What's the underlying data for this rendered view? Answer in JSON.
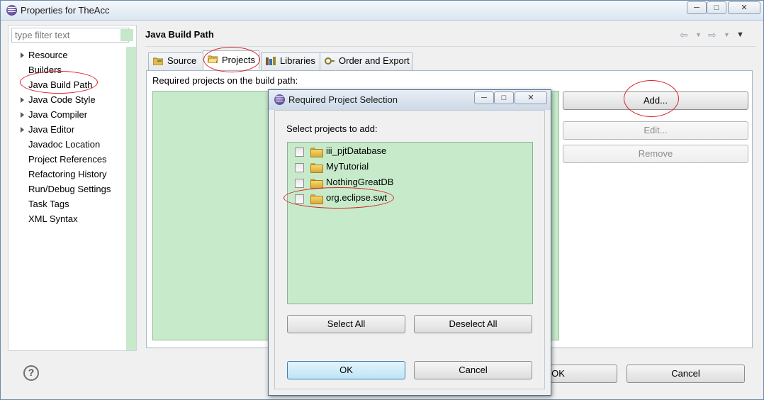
{
  "window": {
    "title": "Properties for TheAcc",
    "controls": {
      "minimize": "─",
      "maximize": "□",
      "close": "✕"
    }
  },
  "sidebar": {
    "filter_placeholder": "type filter text",
    "items": [
      {
        "label": "Resource",
        "expandable": true
      },
      {
        "label": "Builders",
        "expandable": false
      },
      {
        "label": "Java Build Path",
        "expandable": false
      },
      {
        "label": "Java Code Style",
        "expandable": true
      },
      {
        "label": "Java Compiler",
        "expandable": true
      },
      {
        "label": "Java Editor",
        "expandable": true
      },
      {
        "label": "Javadoc Location",
        "expandable": false
      },
      {
        "label": "Project References",
        "expandable": false
      },
      {
        "label": "Refactoring History",
        "expandable": false
      },
      {
        "label": "Run/Debug Settings",
        "expandable": false
      },
      {
        "label": "Task Tags",
        "expandable": false
      },
      {
        "label": "XML Syntax",
        "expandable": false
      }
    ]
  },
  "page": {
    "title": "Java Build Path",
    "tabs": [
      {
        "label": "Source",
        "icon": "source-folder-icon"
      },
      {
        "label": "Projects",
        "icon": "project-folder-icon",
        "active": true
      },
      {
        "label": "Libraries",
        "icon": "libraries-icon"
      },
      {
        "label": "Order and Export",
        "icon": "order-export-icon"
      }
    ],
    "required_label": "Required projects on the build path:",
    "buttons": {
      "add": "Add...",
      "edit": "Edit...",
      "remove": "Remove"
    }
  },
  "footer": {
    "ok": "OK",
    "cancel": "Cancel"
  },
  "dialog": {
    "title": "Required Project Selection",
    "select_label": "Select projects to add:",
    "projects": [
      {
        "name": "iii_pjtDatabase",
        "checked": false
      },
      {
        "name": "MyTutorial",
        "checked": false
      },
      {
        "name": "NothingGreatDB",
        "checked": false
      },
      {
        "name": "org.eclipse.swt",
        "checked": false
      }
    ],
    "select_all": "Select All",
    "deselect_all": "Deselect All",
    "ok": "OK",
    "cancel": "Cancel"
  },
  "colors": {
    "list_background": "#c7ebca",
    "annotation": "#d9232a",
    "default_button": "#bde4f8"
  }
}
